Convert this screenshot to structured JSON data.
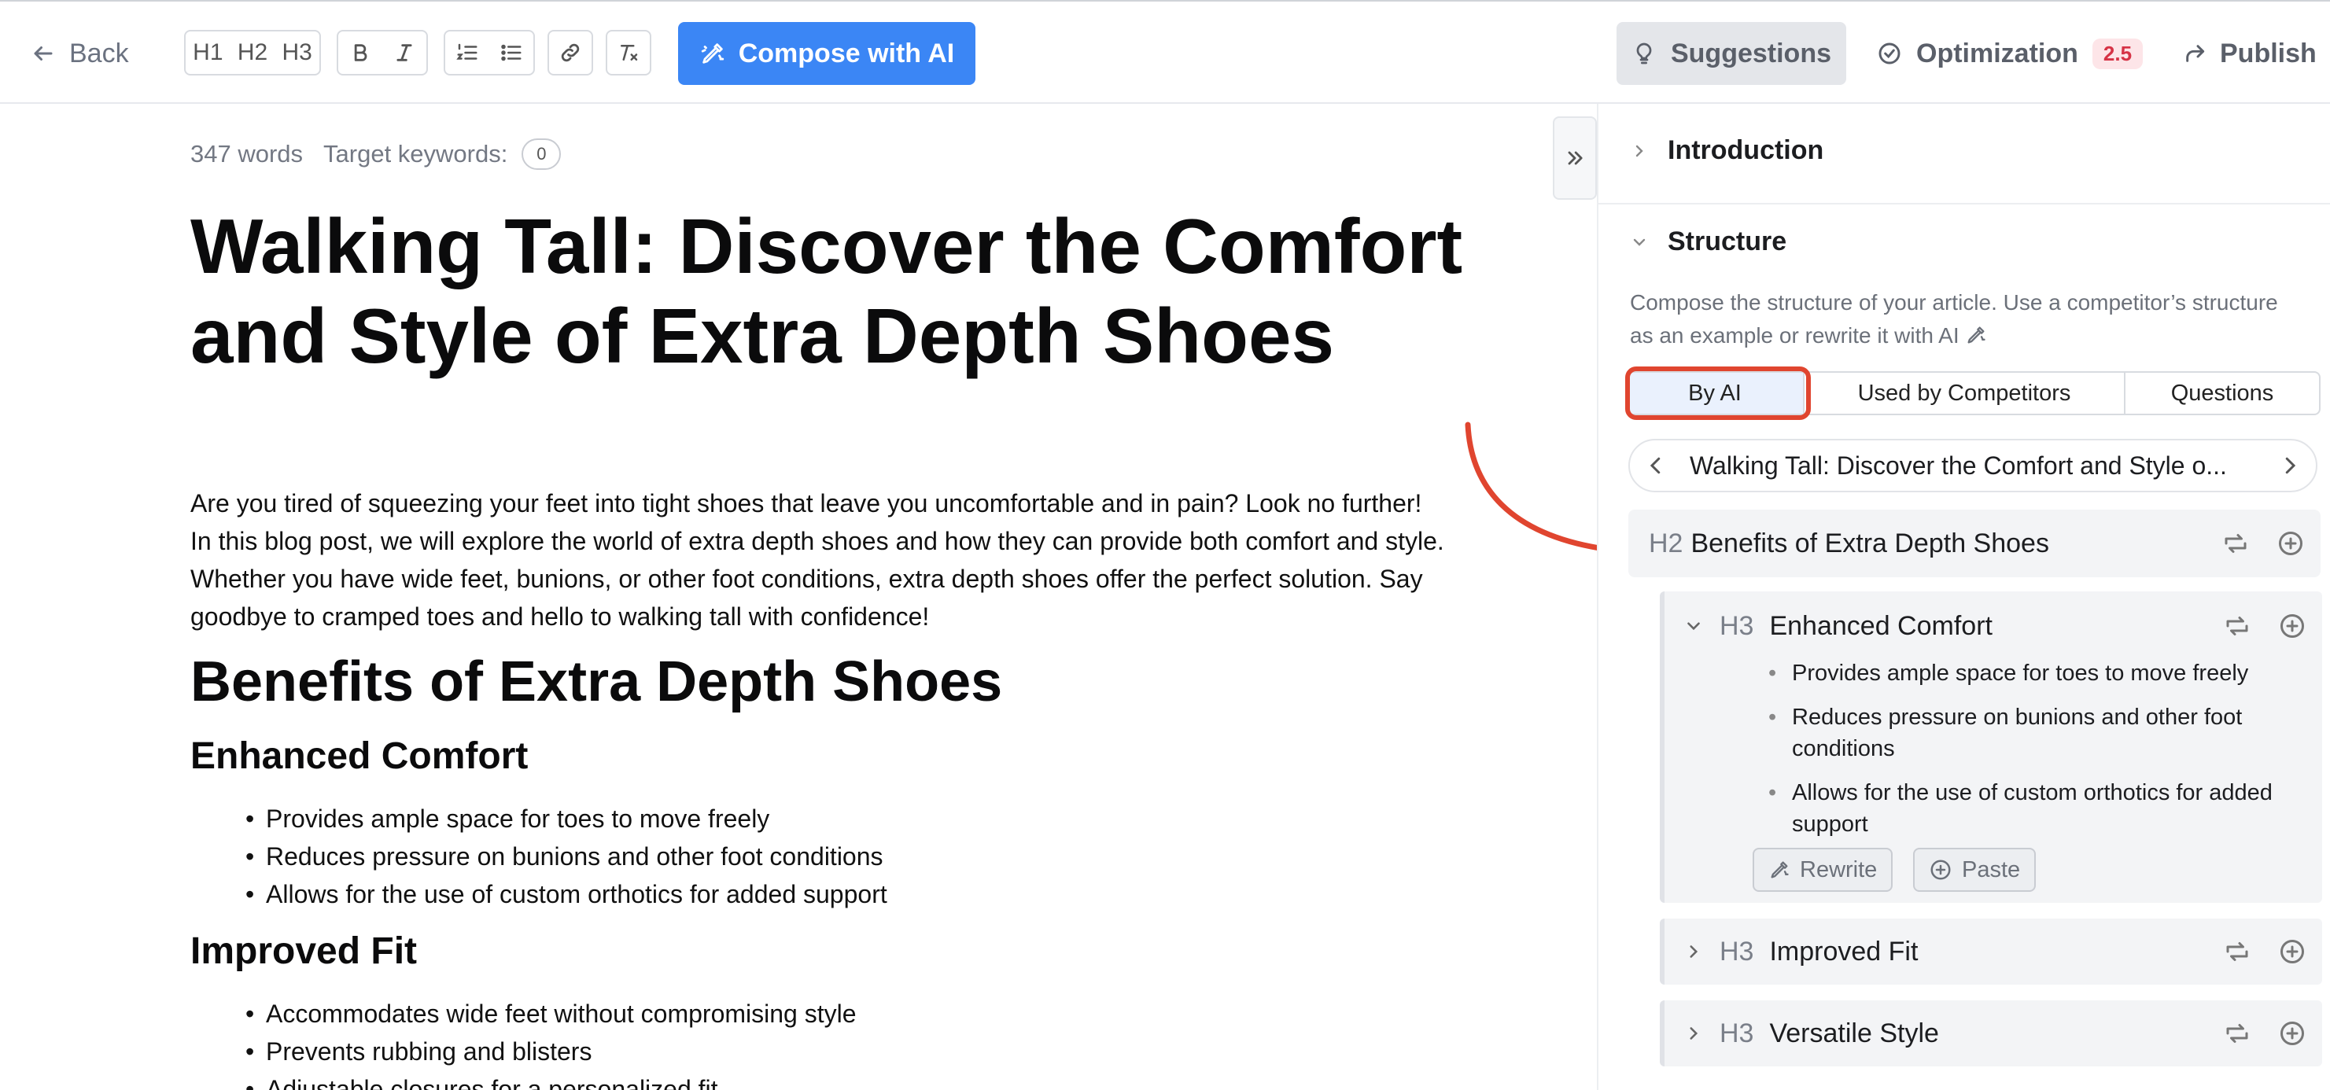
{
  "toolbar": {
    "back_label": "Back",
    "heading_buttons": [
      "H1",
      "H2",
      "H3"
    ],
    "compose_label": "Compose with AI",
    "suggestions_label": "Suggestions",
    "optimization_label": "Optimization",
    "optimization_score": "2.5",
    "publish_label": "Publish"
  },
  "editor": {
    "word_count": "347 words",
    "target_keywords_label": "Target keywords:",
    "target_keywords_count": "0",
    "title": "Walking Tall: Discover the Comfort and Style of Extra Depth Shoes",
    "intro": "Are you tired of squeezing your feet into tight shoes that leave you uncomfortable and in pain? Look no further! In this blog post, we will explore the world of extra depth shoes and how they can provide both comfort and style. Whether you have wide feet, bunions, or other foot conditions, extra depth shoes offer the perfect solution. Say goodbye to cramped toes and hello to walking tall with confidence!",
    "h2_benefits": "Benefits of Extra Depth Shoes",
    "h3_comfort": "Enhanced Comfort",
    "comfort_items": [
      "Provides ample space for toes to move freely",
      "Reduces pressure on bunions and other foot conditions",
      "Allows for the use of custom orthotics for added support"
    ],
    "h3_fit": "Improved Fit",
    "fit_items": [
      "Accommodates wide feet without compromising style",
      "Prevents rubbing and blisters",
      "Adjustable closures for a personalized fit"
    ]
  },
  "panel": {
    "introduction_label": "Introduction",
    "structure_label": "Structure",
    "structure_desc": "Compose the structure of your article. Use a competitor’s structure as an example or rewrite it with AI",
    "tabs": [
      "By AI",
      "Used by Competitors",
      "Questions"
    ],
    "active_tab": "By AI",
    "variant_title": "Walking Tall: Discover the Comfort and Style o...",
    "h2_tag": "H2",
    "h2_label": "Benefits of Extra Depth Shoes",
    "h3_tag": "H3",
    "h3_comfort_label": "Enhanced Comfort",
    "h3_comfort_items": [
      "Provides ample space for toes to move freely",
      "Reduces pressure on bunions and other foot conditions",
      "Allows for the use of custom orthotics for added support"
    ],
    "rewrite_label": "Rewrite",
    "paste_label": "Paste",
    "h3_fit_label": "Improved Fit",
    "h3_style_label": "Versatile Style"
  },
  "colors": {
    "accent_blue": "#3b86f5",
    "annotation_red": "#e0452f",
    "badge_red": "#d63346"
  }
}
